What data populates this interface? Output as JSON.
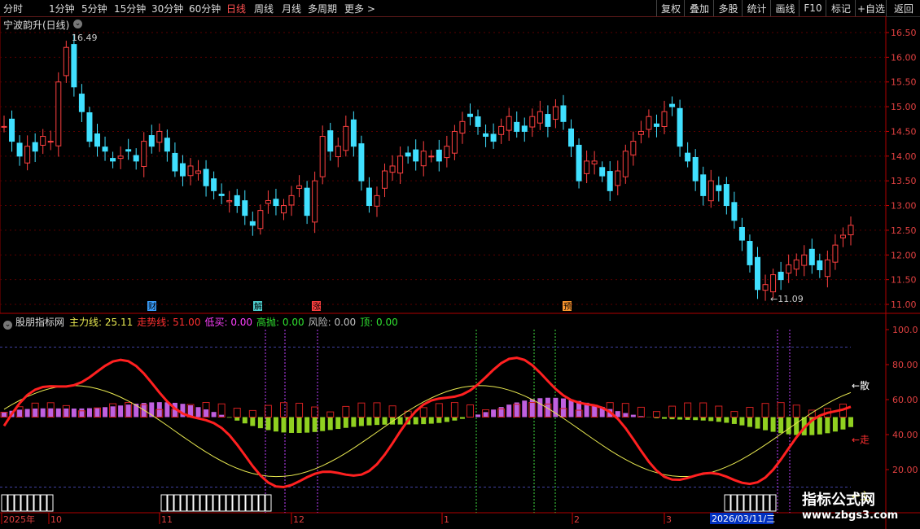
{
  "toolbar": {
    "periods": [
      "分时",
      "1分钟",
      "5分钟",
      "15分钟",
      "30分钟",
      "60分钟",
      "日线",
      "周线",
      "月线",
      "多周期",
      "更多 >"
    ],
    "active_period": "日线",
    "right_buttons": [
      "复权",
      "叠加",
      "多股",
      "统计",
      "画线",
      "F10",
      "标记",
      "+自选",
      "返回"
    ]
  },
  "stock": {
    "title": "宁波韵升(日线)",
    "high_marker": "16.49",
    "low_marker": "←11.09"
  },
  "price_axis": [
    "16.50",
    "16.00",
    "15.50",
    "15.00",
    "14.50",
    "14.00",
    "13.50",
    "13.00",
    "12.50",
    "12.00",
    "11.50",
    "11.00"
  ],
  "events": [
    {
      "label": "财",
      "color": "#3aa0ff"
    },
    {
      "label": "解",
      "color": "#4fd0d0"
    },
    {
      "label": "涨",
      "color": "#ff4040"
    },
    {
      "label": "预",
      "color": "#ff9a30"
    }
  ],
  "indicator": {
    "name": "股朋指标网",
    "items": [
      {
        "label": "主力线:",
        "value": "25.11",
        "color": "#e8e850"
      },
      {
        "label": "走势线:",
        "value": "51.00",
        "color": "#ff3030"
      },
      {
        "label": "低买:",
        "value": "0.00",
        "color": "#ff40ff"
      },
      {
        "label": "高抛:",
        "value": "0.00",
        "color": "#30e030"
      },
      {
        "label": "风险:",
        "value": "0.00",
        "color": "#c0c0c0"
      },
      {
        "label": "顶:",
        "value": "0.00",
        "color": "#30e030"
      }
    ],
    "axis": [
      "100.0",
      "80.00",
      "60.00",
      "40.00",
      "20.00"
    ],
    "right_labels": [
      "←散",
      "←走",
      "←主"
    ]
  },
  "time_axis": {
    "labels": [
      "2025年",
      "10",
      "11",
      "12",
      "1",
      "2",
      "3"
    ],
    "cursor_date": "2026/03/11/三"
  },
  "watermark": {
    "line1": "指标公式网",
    "line2": "www.zbgs3.com"
  }
}
